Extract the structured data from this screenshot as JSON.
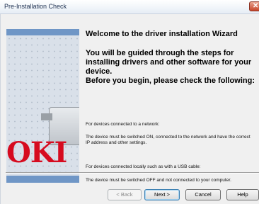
{
  "window": {
    "title": "Pre-Installation Check",
    "close_glyph": "✕"
  },
  "side": {
    "logo_text": "OKI",
    "logo_color": "#d60b1f",
    "band_color": "#6f96c6"
  },
  "main": {
    "heading": "Welcome to the driver installation Wizard",
    "intro_line1": "You will be guided through the steps for installing drivers and other software for your device.",
    "intro_line2": "Before you begin, please check the following:",
    "network_label": "For devices connected to a network:",
    "network_text": "The device must be switched ON, connected to the network and have the correct IP address and other settings.",
    "usb_label": "For devices connected locally such as with a USB cable:",
    "usb_text": "The device must be switched OFF and not connected to your computer."
  },
  "buttons": {
    "back": "< Back",
    "next": "Next >",
    "cancel": "Cancel",
    "help": "Help"
  }
}
